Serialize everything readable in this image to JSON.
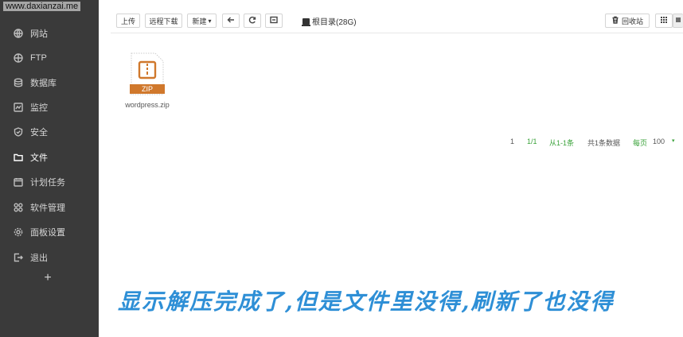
{
  "watermark": "www.daxianzai.me",
  "sidebar": {
    "items": [
      {
        "label": "网站",
        "icon": "globe-icon"
      },
      {
        "label": "FTP",
        "icon": "ftp-globe-icon"
      },
      {
        "label": "数据库",
        "icon": "database-icon"
      },
      {
        "label": "监控",
        "icon": "monitor-icon"
      },
      {
        "label": "安全",
        "icon": "shield-icon"
      },
      {
        "label": "文件",
        "icon": "folder-icon",
        "active": true
      },
      {
        "label": "计划任务",
        "icon": "calendar-icon"
      },
      {
        "label": "软件管理",
        "icon": "grid-icon"
      },
      {
        "label": "面板设置",
        "icon": "gear-icon"
      },
      {
        "label": "退出",
        "icon": "logout-icon"
      }
    ],
    "add_symbol": "+"
  },
  "toolbar": {
    "upload": "上传",
    "remote_download": "远程下载",
    "new": "新建",
    "new_caret": "▾",
    "root_path": "根目录(28G)",
    "recycle_bin": "回收站"
  },
  "files": [
    {
      "name": "wordpress.zip",
      "type_badge": "ZIP"
    }
  ],
  "pager": {
    "page": "1",
    "page_of": "1/1",
    "range": "从1-1条",
    "total": "共1条数据",
    "per_page_label": "每页",
    "per_page_value": "100",
    "per_page_caret": "▾"
  },
  "caption": "显示解压完成了,但是文件里没得,刷新了也没得",
  "colors": {
    "sidebar_bg": "#3a3a3a",
    "zip_orange": "#d0782c",
    "pager_green": "#3aa23a",
    "caption_blue": "#2e8fd6"
  }
}
